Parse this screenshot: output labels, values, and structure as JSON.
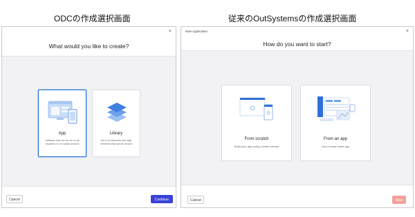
{
  "left_heading": "ODCの作成選択画面",
  "right_heading": "従来のOutSystemsの作成選択画面",
  "odc_dialog": {
    "close_label": "×",
    "question": "What would you like to create?",
    "cards": [
      {
        "title": "App",
        "description": "Software that can be run on all browsers or on mobile devices"
      },
      {
        "title": "Library",
        "description": "Set of UI elements and logic elements that can be reused"
      }
    ],
    "cancel_label": "Cancel",
    "continue_label": "Continue",
    "colors": {
      "primary": "#3a43d6",
      "selected_border": "#1f6fd6"
    }
  },
  "outsystems_dialog": {
    "title": "New Application",
    "close_label": "×",
    "question": "How do you want to start?",
    "cards": [
      {
        "title": "From scratch",
        "description": "Build your app using a blank canvas"
      },
      {
        "title": "From an app",
        "description": "Use a ready made app"
      }
    ],
    "cancel_label": "Cancel",
    "next_label": "Next",
    "colors": {
      "next_disabled": "#f2a19a"
    }
  }
}
